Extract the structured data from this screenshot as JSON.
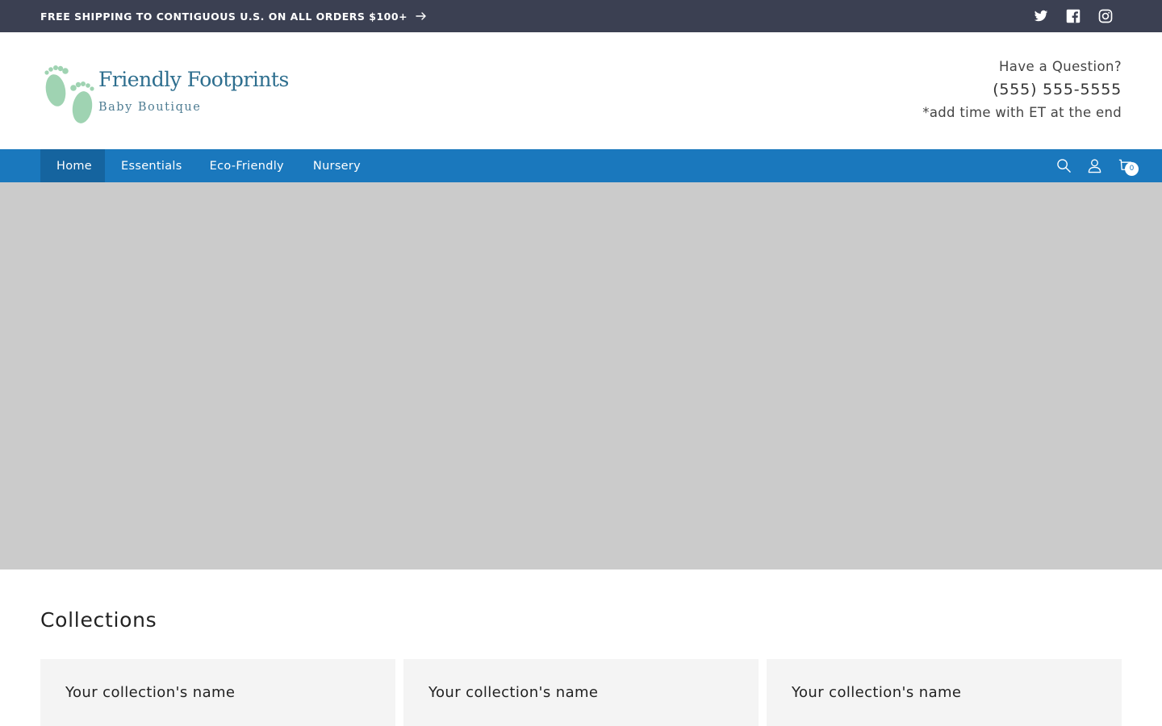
{
  "announcement": {
    "text": "FREE SHIPPING TO CONTIGUOUS U.S. ON ALL ORDERS $100+",
    "icon": "arrow-right-icon"
  },
  "social": [
    {
      "name": "Twitter",
      "icon": "twitter-icon"
    },
    {
      "name": "Facebook",
      "icon": "facebook-icon"
    },
    {
      "name": "Instagram",
      "icon": "instagram-icon"
    }
  ],
  "logo": {
    "name": "Friendly Footprints",
    "tagline": "Baby Boutique",
    "colors": {
      "feet": "#9fd3b2",
      "text": "#2d6e8e"
    }
  },
  "contact": {
    "question": "Have a Question?",
    "phone": "(555) 555-5555",
    "note": "*add time with ET at the end"
  },
  "nav": {
    "items": [
      {
        "label": "Home",
        "active": true
      },
      {
        "label": "Essentials",
        "active": false
      },
      {
        "label": "Eco-Friendly",
        "active": false
      },
      {
        "label": "Nursery",
        "active": false
      }
    ],
    "icons": [
      "search-icon",
      "account-icon",
      "cart-icon"
    ],
    "cart_count": "0",
    "color": "#1a78bd"
  },
  "hero": {
    "placeholder_color": "#cbcbcb"
  },
  "collections": {
    "title": "Collections",
    "cards": [
      {
        "name": "Your collection's name"
      },
      {
        "name": "Your collection's name"
      },
      {
        "name": "Your collection's name"
      }
    ]
  },
  "colors": {
    "announcement_bg": "#3b4052",
    "nav_bg": "#1a78bd",
    "nav_active_bg": "#15649f",
    "card_bg": "#f4f4f4"
  }
}
